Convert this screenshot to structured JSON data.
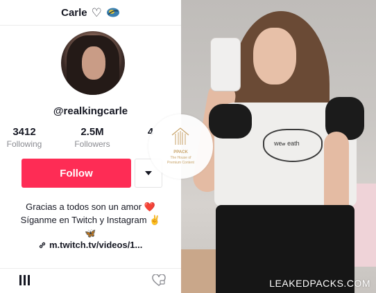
{
  "profile": {
    "name": "Carle",
    "handle": "@realkingcarle",
    "stats": [
      {
        "value": "3412",
        "label": "Following"
      },
      {
        "value": "2.5M",
        "label": "Followers"
      },
      {
        "value": "4",
        "label": ""
      }
    ],
    "follow_label": "Follow",
    "bio_lines": [
      "Gracias a todos son un amor ❤️",
      "Síganme en Twitch y Instagram ✌",
      "🦋"
    ],
    "link": "m.twitch.tv/videos/1..."
  },
  "watermark": {
    "brand": "PPACK",
    "tagline": "The House of Premium Content",
    "footer": "LEAKEDPACKS.COM"
  },
  "photo": {
    "shirt_text": "we𝓊 eath"
  },
  "colors": {
    "follow_red": "#fe2c55",
    "watermark_gold": "#c7a267"
  },
  "icons": {
    "heart": "heart-outline-icon",
    "emoji": "globe-emoji-icon",
    "link": "link-icon",
    "dropdown": "caret-down-icon",
    "grid_tab": "videos-grid-icon",
    "liked_tab": "liked-videos-icon"
  }
}
